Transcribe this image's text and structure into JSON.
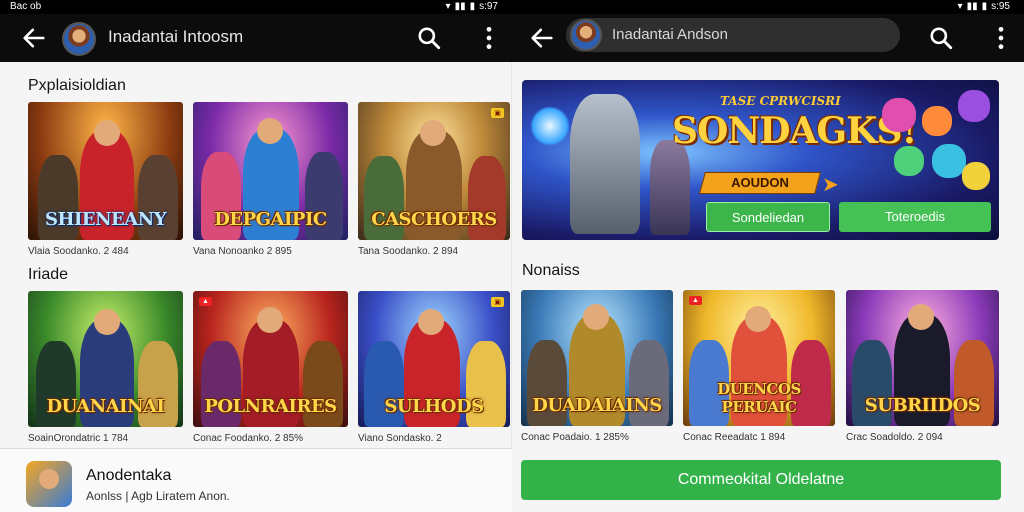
{
  "status": {
    "time": "Bac ob",
    "right_text": "s:97",
    "right_text_2": "s:95"
  },
  "left": {
    "app_title": "Inadantai Intoosm",
    "sections": [
      {
        "title": "Pxplaisioldian",
        "cards": [
          {
            "logo": "SHIENEANY",
            "caption": "Vlaia Soodanko. 2 484",
            "badge": ""
          },
          {
            "logo": "DEPGAIPIC",
            "caption": "Vana Nonoanko 2 895",
            "badge": ""
          },
          {
            "logo": "CASCHOERS",
            "caption": "Tana Soodanko. 2 894",
            "badge": ""
          }
        ]
      },
      {
        "title": "Iriade",
        "cards": [
          {
            "logo": "DUANAINAI",
            "caption": "SoainOrondatric 1 784",
            "badge": ""
          },
          {
            "logo": "POLNRAIRES",
            "caption": "Conac Foodanko. 2 85%",
            "badge": ""
          },
          {
            "logo": "SULHODS",
            "caption": "Viano Sondasko. 2",
            "badge": ""
          }
        ]
      }
    ],
    "bottom": {
      "name": "Anodentaka",
      "subtitle": "Aonlss | Agb Liratem Anon."
    }
  },
  "right": {
    "app_title": "Inadantai Andson",
    "banner": {
      "tagline": "TASE CPRWCISRI",
      "title": "SONDAGKS!",
      "ribbon": "AOUDON",
      "button_1": "Sondeliedan",
      "button_2": "Toteroedis"
    },
    "section_title": "Nonaiss",
    "cards": [
      {
        "logo": "DUADAIAINS",
        "caption": "Conac Poadaio. 1 285%"
      },
      {
        "logo": "DUENCOS PERUAIC",
        "caption": "Conac Reeadatc 1 894"
      },
      {
        "logo": "SUBRIIDOS",
        "caption": "Crac Soadoldo. 2 094"
      }
    ],
    "cta": "Commeokital Oldelatne"
  }
}
